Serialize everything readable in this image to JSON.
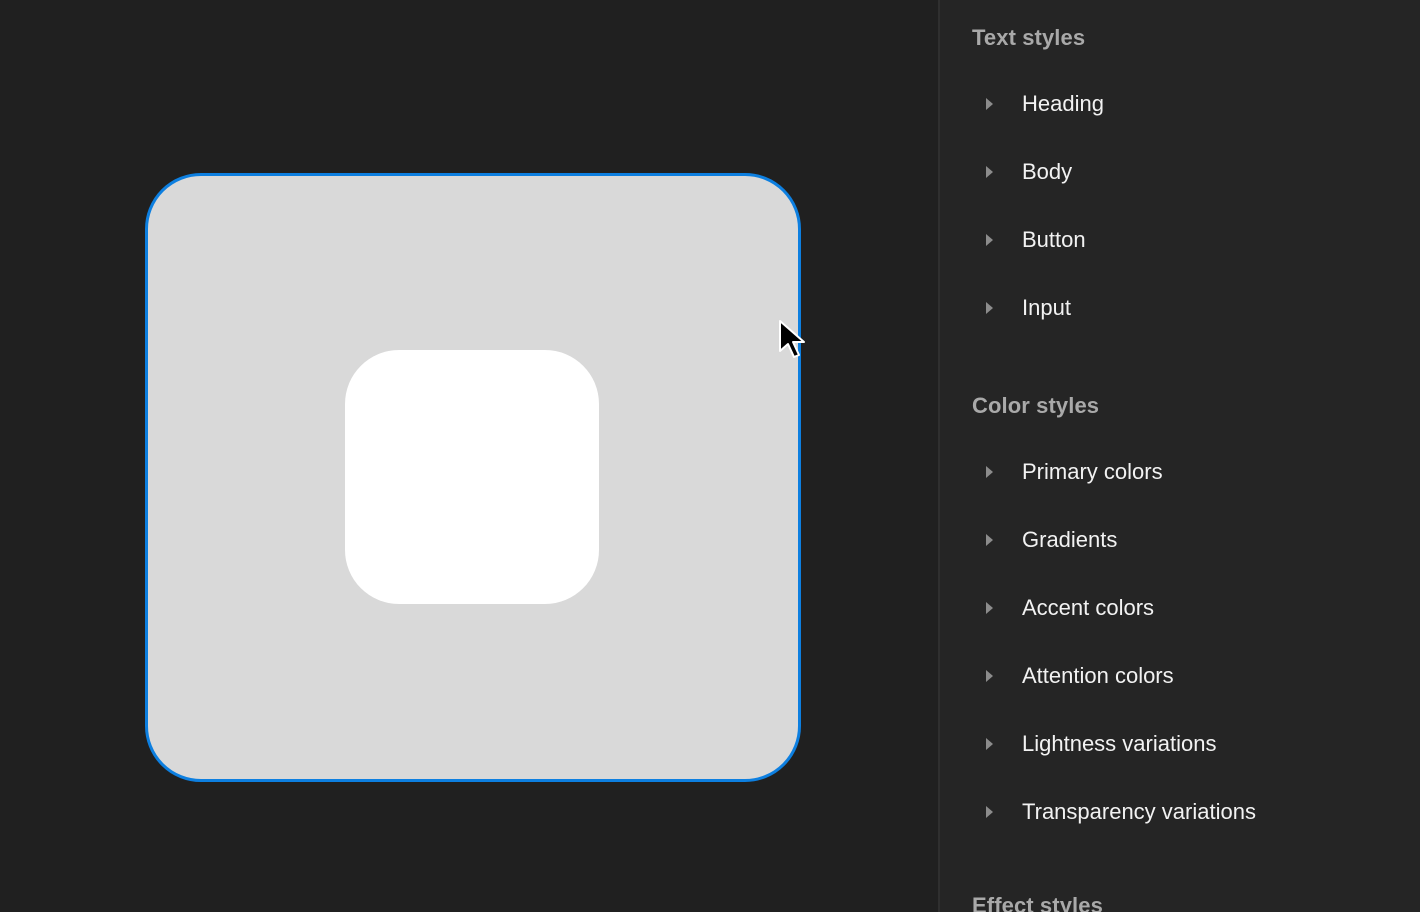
{
  "panel": {
    "sections": [
      {
        "title": "Text styles",
        "items": [
          "Heading",
          "Body",
          "Button",
          "Input"
        ]
      },
      {
        "title": "Color styles",
        "items": [
          "Primary colors",
          "Gradients",
          "Accent colors",
          "Attention colors",
          "Lightness variations",
          "Transparency variations"
        ]
      },
      {
        "title": "Effect styles",
        "items": []
      }
    ]
  },
  "colors": {
    "canvas_bg": "#202020",
    "panel_bg": "#252525",
    "selection": "#0d7fe0",
    "frame_fill": "#d9d9d9",
    "inner_fill": "#ffffff"
  },
  "icons": {
    "expand": "caret-right-icon",
    "pointer": "mouse-cursor-icon"
  }
}
